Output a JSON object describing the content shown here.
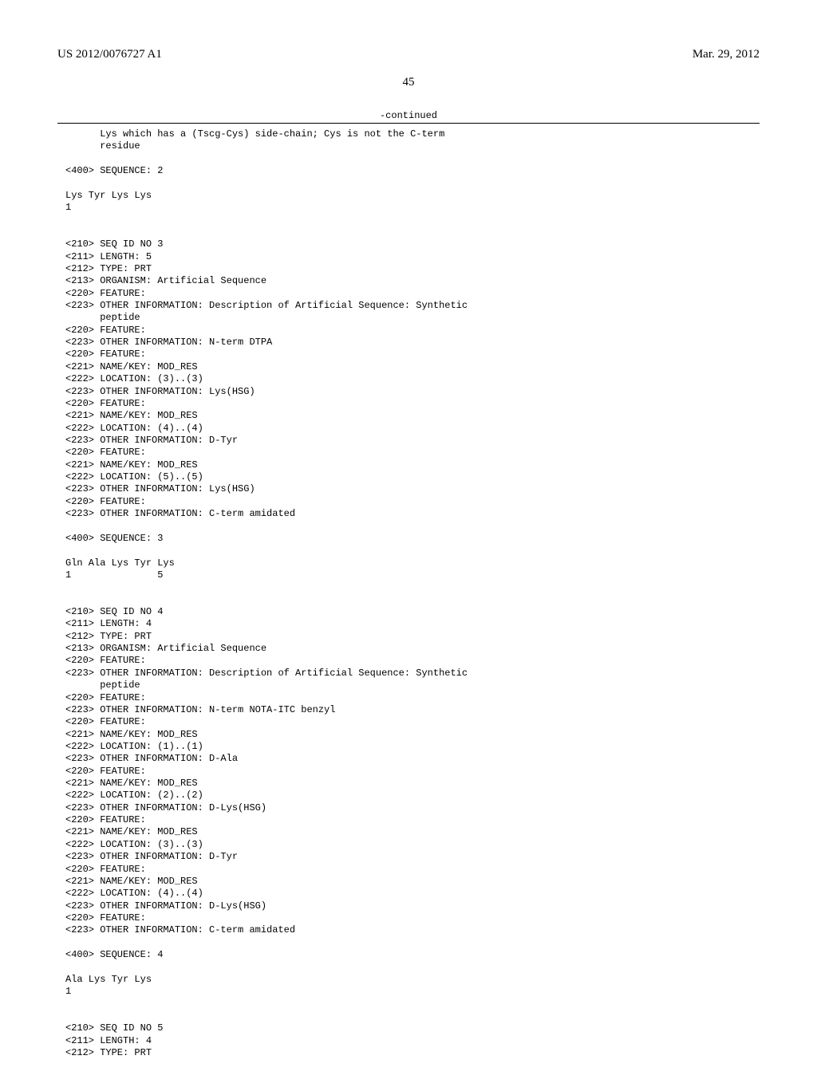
{
  "header": {
    "pub_number": "US 2012/0076727 A1",
    "pub_date": "Mar. 29, 2012"
  },
  "page_number": "45",
  "continued_label": "-continued",
  "seq_listing": "      Lys which has a (Tscg-Cys) side-chain; Cys is not the C-term\n      residue\n\n<400> SEQUENCE: 2\n\nLys Tyr Lys Lys\n1\n\n\n<210> SEQ ID NO 3\n<211> LENGTH: 5\n<212> TYPE: PRT\n<213> ORGANISM: Artificial Sequence\n<220> FEATURE:\n<223> OTHER INFORMATION: Description of Artificial Sequence: Synthetic\n      peptide\n<220> FEATURE:\n<223> OTHER INFORMATION: N-term DTPA\n<220> FEATURE:\n<221> NAME/KEY: MOD_RES\n<222> LOCATION: (3)..(3)\n<223> OTHER INFORMATION: Lys(HSG)\n<220> FEATURE:\n<221> NAME/KEY: MOD_RES\n<222> LOCATION: (4)..(4)\n<223> OTHER INFORMATION: D-Tyr\n<220> FEATURE:\n<221> NAME/KEY: MOD_RES\n<222> LOCATION: (5)..(5)\n<223> OTHER INFORMATION: Lys(HSG)\n<220> FEATURE:\n<223> OTHER INFORMATION: C-term amidated\n\n<400> SEQUENCE: 3\n\nGln Ala Lys Tyr Lys\n1               5\n\n\n<210> SEQ ID NO 4\n<211> LENGTH: 4\n<212> TYPE: PRT\n<213> ORGANISM: Artificial Sequence\n<220> FEATURE:\n<223> OTHER INFORMATION: Description of Artificial Sequence: Synthetic\n      peptide\n<220> FEATURE:\n<223> OTHER INFORMATION: N-term NOTA-ITC benzyl\n<220> FEATURE:\n<221> NAME/KEY: MOD_RES\n<222> LOCATION: (1)..(1)\n<223> OTHER INFORMATION: D-Ala\n<220> FEATURE:\n<221> NAME/KEY: MOD_RES\n<222> LOCATION: (2)..(2)\n<223> OTHER INFORMATION: D-Lys(HSG)\n<220> FEATURE:\n<221> NAME/KEY: MOD_RES\n<222> LOCATION: (3)..(3)\n<223> OTHER INFORMATION: D-Tyr\n<220> FEATURE:\n<221> NAME/KEY: MOD_RES\n<222> LOCATION: (4)..(4)\n<223> OTHER INFORMATION: D-Lys(HSG)\n<220> FEATURE:\n<223> OTHER INFORMATION: C-term amidated\n\n<400> SEQUENCE: 4\n\nAla Lys Tyr Lys\n1\n\n\n<210> SEQ ID NO 5\n<211> LENGTH: 4\n<212> TYPE: PRT"
}
